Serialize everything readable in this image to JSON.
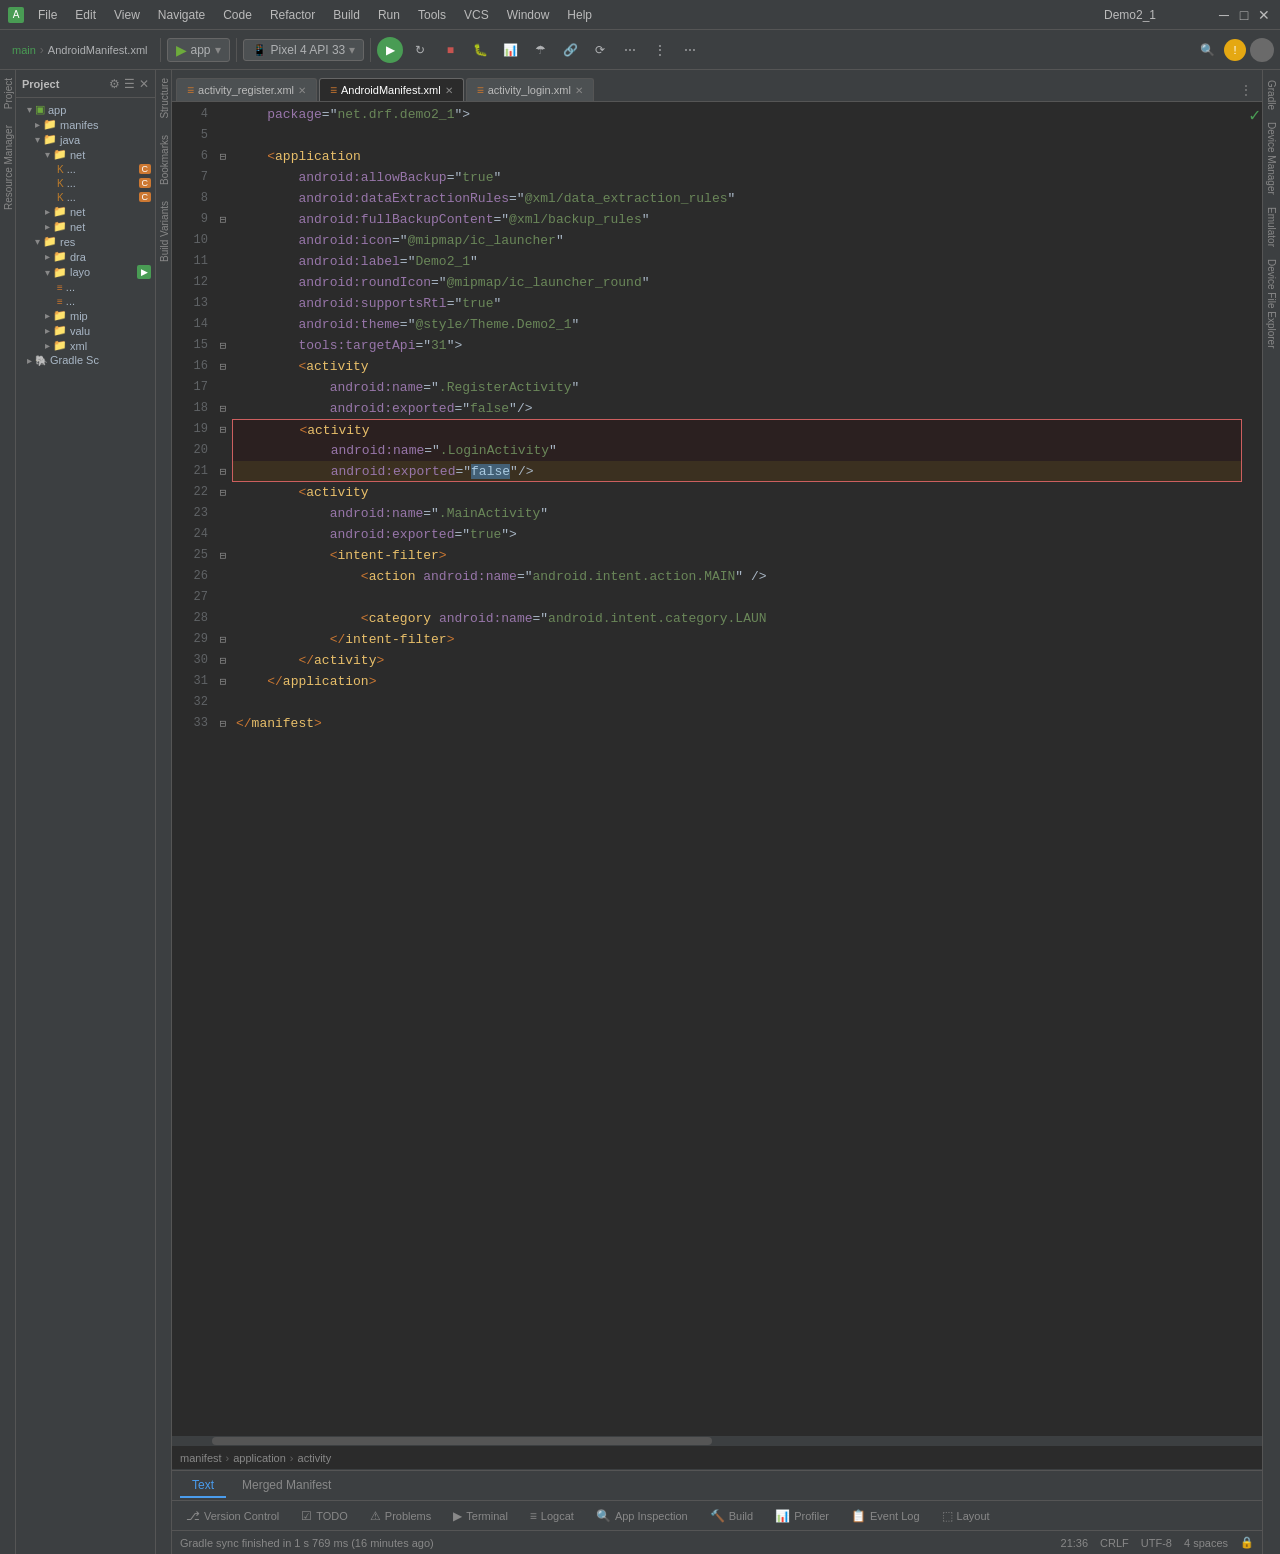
{
  "titleBar": {
    "menus": [
      "File",
      "Edit",
      "View",
      "Navigate",
      "Code",
      "Refactor",
      "Build",
      "Run",
      "Tools",
      "VCS",
      "Window",
      "Help"
    ],
    "title": "Demo2_1",
    "minimize": "─",
    "maximize": "□",
    "close": "✕"
  },
  "toolbar": {
    "main_label": "main",
    "manifest_label": "AndroidManifest.xml",
    "app_dropdown": "app",
    "device_dropdown": "Pixel 4 API 33"
  },
  "tabs": [
    {
      "id": "tab-register",
      "label": "activity_register.xml",
      "active": false
    },
    {
      "id": "tab-manifest",
      "label": "AndroidManifest.xml",
      "active": true
    },
    {
      "id": "tab-login",
      "label": "activity_login.xml",
      "active": false
    }
  ],
  "breadcrumb": {
    "items": [
      "manifest",
      "application",
      "activity"
    ]
  },
  "projectPanel": {
    "title": "Project",
    "root": "app",
    "items": [
      {
        "indent": 1,
        "type": "folder",
        "label": "manifes",
        "expanded": true
      },
      {
        "indent": 2,
        "type": "folder",
        "label": "java",
        "expanded": false
      },
      {
        "indent": 3,
        "type": "folder",
        "label": "net",
        "expanded": true
      },
      {
        "indent": 4,
        "type": "file-c",
        "label": "C"
      },
      {
        "indent": 4,
        "type": "file-c",
        "label": "C"
      },
      {
        "indent": 4,
        "type": "file-c",
        "label": "C"
      },
      {
        "indent": 3,
        "type": "folder",
        "label": "net",
        "expanded": false
      },
      {
        "indent": 3,
        "type": "folder",
        "label": "net",
        "expanded": false
      },
      {
        "indent": 2,
        "type": "folder",
        "label": "res",
        "expanded": true
      },
      {
        "indent": 3,
        "type": "folder",
        "label": "dra",
        "expanded": false
      },
      {
        "indent": 3,
        "type": "folder",
        "label": "layo",
        "expanded": true,
        "badge": "green"
      },
      {
        "indent": 4,
        "type": "xml",
        "label": ""
      },
      {
        "indent": 4,
        "type": "xml",
        "label": ""
      },
      {
        "indent": 3,
        "type": "folder",
        "label": "mip",
        "expanded": false
      },
      {
        "indent": 3,
        "type": "folder",
        "label": "valu",
        "expanded": false
      },
      {
        "indent": 3,
        "type": "folder",
        "label": "xml",
        "expanded": false
      },
      {
        "indent": 1,
        "type": "gradle",
        "label": "Gradle Sc",
        "expanded": false
      }
    ]
  },
  "code": {
    "lines": [
      {
        "num": 4,
        "indent": 0,
        "content": "    package=\"net.drf.demo2_1\">",
        "type": "xml-text"
      },
      {
        "num": 5,
        "indent": 0,
        "content": "",
        "type": "empty"
      },
      {
        "num": 6,
        "indent": 0,
        "content": "    <application",
        "type": "xml-open"
      },
      {
        "num": 7,
        "indent": 0,
        "content": "        android:allowBackup=\"true\"",
        "type": "xml-attr"
      },
      {
        "num": 8,
        "indent": 0,
        "content": "        android:dataExtractionRules=\"@xml/data_extraction_rules\"",
        "type": "xml-attr"
      },
      {
        "num": 9,
        "indent": 0,
        "content": "        android:fullBackupContent=\"@xml/backup_rules\"",
        "type": "xml-attr"
      },
      {
        "num": 10,
        "indent": 0,
        "content": "        android:icon=\"@mipmap/ic_launcher\"",
        "type": "xml-attr"
      },
      {
        "num": 11,
        "indent": 0,
        "content": "        android:label=\"Demo2_1\"",
        "type": "xml-attr"
      },
      {
        "num": 12,
        "indent": 0,
        "content": "        android:roundIcon=\"@mipmap/ic_launcher_round\"",
        "type": "xml-attr"
      },
      {
        "num": 13,
        "indent": 0,
        "content": "        android:supportsRtl=\"true\"",
        "type": "xml-attr"
      },
      {
        "num": 14,
        "indent": 0,
        "content": "        android:theme=\"@style/Theme.Demo2_1\"",
        "type": "xml-attr"
      },
      {
        "num": 15,
        "indent": 0,
        "content": "        tools:targetApi=\"31\">",
        "type": "xml-attr"
      },
      {
        "num": 16,
        "indent": 0,
        "content": "        <activity",
        "type": "xml-open"
      },
      {
        "num": 17,
        "indent": 0,
        "content": "            android:name=\".RegisterActivity\"",
        "type": "xml-attr"
      },
      {
        "num": 18,
        "indent": 0,
        "content": "            android:exported=\"false\"/>",
        "type": "xml-attr-close"
      },
      {
        "num": 19,
        "indent": 0,
        "content": "        <activity",
        "type": "xml-open-highlight"
      },
      {
        "num": 20,
        "indent": 0,
        "content": "            android:name=\".LoginActivity\"",
        "type": "xml-attr-highlight"
      },
      {
        "num": 21,
        "indent": 0,
        "content": "            android:exported=\"false\"/>",
        "type": "xml-attr-highlight-cursor"
      },
      {
        "num": 22,
        "indent": 0,
        "content": "        <activity",
        "type": "xml-open"
      },
      {
        "num": 23,
        "indent": 0,
        "content": "            android:name=\".MainActivity\"",
        "type": "xml-attr"
      },
      {
        "num": 24,
        "indent": 0,
        "content": "            android:exported=\"true\">",
        "type": "xml-attr"
      },
      {
        "num": 25,
        "indent": 0,
        "content": "            <intent-filter>",
        "type": "xml-open"
      },
      {
        "num": 26,
        "indent": 0,
        "content": "                <action android:name=\"android.intent.action.MAIN\" />",
        "type": "xml-attr"
      },
      {
        "num": 27,
        "indent": 0,
        "content": "",
        "type": "empty"
      },
      {
        "num": 28,
        "indent": 0,
        "content": "                <category android:name=\"android.intent.category.LAUN",
        "type": "xml-attr"
      },
      {
        "num": 29,
        "indent": 0,
        "content": "            </intent-filter>",
        "type": "xml-close"
      },
      {
        "num": 30,
        "indent": 0,
        "content": "        </activity>",
        "type": "xml-close"
      },
      {
        "num": 31,
        "indent": 0,
        "content": "    </application>",
        "type": "xml-close"
      },
      {
        "num": 32,
        "indent": 0,
        "content": "",
        "type": "empty"
      },
      {
        "num": 33,
        "indent": 0,
        "content": "</manifest>",
        "type": "xml-close"
      }
    ]
  },
  "subTabs": {
    "text": "Text",
    "merged": "Merged Manifest"
  },
  "bottomTabs": [
    {
      "id": "version-control",
      "icon": "⎇",
      "label": "Version Control"
    },
    {
      "id": "todo",
      "icon": "☑",
      "label": "TODO"
    },
    {
      "id": "problems",
      "icon": "⚠",
      "label": "Problems"
    },
    {
      "id": "terminal",
      "icon": "▶",
      "label": "Terminal"
    },
    {
      "id": "logcat",
      "icon": "≡",
      "label": "Logcat"
    },
    {
      "id": "app-inspection",
      "icon": "🔍",
      "label": "App Inspection"
    },
    {
      "id": "build",
      "icon": "🔨",
      "label": "Build"
    },
    {
      "id": "profiler",
      "icon": "📊",
      "label": "Profiler"
    },
    {
      "id": "event-log",
      "icon": "📋",
      "label": "Event Log"
    },
    {
      "id": "layout",
      "icon": "⬚",
      "label": "Layout"
    }
  ],
  "statusBar": {
    "message": "Gradle sync finished in 1 s 769 ms (16 minutes ago)",
    "time": "21:36",
    "encoding": "CRLF",
    "charset": "UTF-8",
    "indent": "4 spaces"
  },
  "rightTabs": [
    {
      "id": "gradle",
      "label": "Gradle"
    },
    {
      "id": "device-manager",
      "label": "Device Manager"
    },
    {
      "id": "emulator",
      "label": "Emulator"
    },
    {
      "id": "device-file",
      "label": "Device File Explorer"
    }
  ],
  "leftTabs": [
    {
      "id": "project",
      "label": "Project"
    },
    {
      "id": "resource",
      "label": "Resource Manager"
    },
    {
      "id": "structure",
      "label": "Structure"
    },
    {
      "id": "bookmarks",
      "label": "Bookmarks"
    },
    {
      "id": "build-variants",
      "label": "Build Variants"
    }
  ]
}
